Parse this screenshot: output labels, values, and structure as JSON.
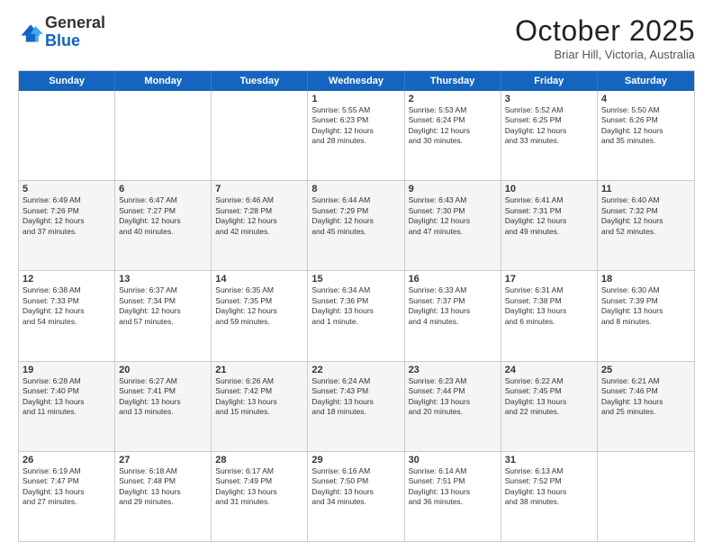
{
  "logo": {
    "general": "General",
    "blue": "Blue"
  },
  "title": "October 2025",
  "location": "Briar Hill, Victoria, Australia",
  "days": [
    "Sunday",
    "Monday",
    "Tuesday",
    "Wednesday",
    "Thursday",
    "Friday",
    "Saturday"
  ],
  "rows": [
    [
      {
        "day": "",
        "info": ""
      },
      {
        "day": "",
        "info": ""
      },
      {
        "day": "",
        "info": ""
      },
      {
        "day": "1",
        "info": "Sunrise: 5:55 AM\nSunset: 6:23 PM\nDaylight: 12 hours\nand 28 minutes."
      },
      {
        "day": "2",
        "info": "Sunrise: 5:53 AM\nSunset: 6:24 PM\nDaylight: 12 hours\nand 30 minutes."
      },
      {
        "day": "3",
        "info": "Sunrise: 5:52 AM\nSunset: 6:25 PM\nDaylight: 12 hours\nand 33 minutes."
      },
      {
        "day": "4",
        "info": "Sunrise: 5:50 AM\nSunset: 6:26 PM\nDaylight: 12 hours\nand 35 minutes."
      }
    ],
    [
      {
        "day": "5",
        "info": "Sunrise: 6:49 AM\nSunset: 7:26 PM\nDaylight: 12 hours\nand 37 minutes."
      },
      {
        "day": "6",
        "info": "Sunrise: 6:47 AM\nSunset: 7:27 PM\nDaylight: 12 hours\nand 40 minutes."
      },
      {
        "day": "7",
        "info": "Sunrise: 6:46 AM\nSunset: 7:28 PM\nDaylight: 12 hours\nand 42 minutes."
      },
      {
        "day": "8",
        "info": "Sunrise: 6:44 AM\nSunset: 7:29 PM\nDaylight: 12 hours\nand 45 minutes."
      },
      {
        "day": "9",
        "info": "Sunrise: 6:43 AM\nSunset: 7:30 PM\nDaylight: 12 hours\nand 47 minutes."
      },
      {
        "day": "10",
        "info": "Sunrise: 6:41 AM\nSunset: 7:31 PM\nDaylight: 12 hours\nand 49 minutes."
      },
      {
        "day": "11",
        "info": "Sunrise: 6:40 AM\nSunset: 7:32 PM\nDaylight: 12 hours\nand 52 minutes."
      }
    ],
    [
      {
        "day": "12",
        "info": "Sunrise: 6:38 AM\nSunset: 7:33 PM\nDaylight: 12 hours\nand 54 minutes."
      },
      {
        "day": "13",
        "info": "Sunrise: 6:37 AM\nSunset: 7:34 PM\nDaylight: 12 hours\nand 57 minutes."
      },
      {
        "day": "14",
        "info": "Sunrise: 6:35 AM\nSunset: 7:35 PM\nDaylight: 12 hours\nand 59 minutes."
      },
      {
        "day": "15",
        "info": "Sunrise: 6:34 AM\nSunset: 7:36 PM\nDaylight: 13 hours\nand 1 minute."
      },
      {
        "day": "16",
        "info": "Sunrise: 6:33 AM\nSunset: 7:37 PM\nDaylight: 13 hours\nand 4 minutes."
      },
      {
        "day": "17",
        "info": "Sunrise: 6:31 AM\nSunset: 7:38 PM\nDaylight: 13 hours\nand 6 minutes."
      },
      {
        "day": "18",
        "info": "Sunrise: 6:30 AM\nSunset: 7:39 PM\nDaylight: 13 hours\nand 8 minutes."
      }
    ],
    [
      {
        "day": "19",
        "info": "Sunrise: 6:28 AM\nSunset: 7:40 PM\nDaylight: 13 hours\nand 11 minutes."
      },
      {
        "day": "20",
        "info": "Sunrise: 6:27 AM\nSunset: 7:41 PM\nDaylight: 13 hours\nand 13 minutes."
      },
      {
        "day": "21",
        "info": "Sunrise: 6:26 AM\nSunset: 7:42 PM\nDaylight: 13 hours\nand 15 minutes."
      },
      {
        "day": "22",
        "info": "Sunrise: 6:24 AM\nSunset: 7:43 PM\nDaylight: 13 hours\nand 18 minutes."
      },
      {
        "day": "23",
        "info": "Sunrise: 6:23 AM\nSunset: 7:44 PM\nDaylight: 13 hours\nand 20 minutes."
      },
      {
        "day": "24",
        "info": "Sunrise: 6:22 AM\nSunset: 7:45 PM\nDaylight: 13 hours\nand 22 minutes."
      },
      {
        "day": "25",
        "info": "Sunrise: 6:21 AM\nSunset: 7:46 PM\nDaylight: 13 hours\nand 25 minutes."
      }
    ],
    [
      {
        "day": "26",
        "info": "Sunrise: 6:19 AM\nSunset: 7:47 PM\nDaylight: 13 hours\nand 27 minutes."
      },
      {
        "day": "27",
        "info": "Sunrise: 6:18 AM\nSunset: 7:48 PM\nDaylight: 13 hours\nand 29 minutes."
      },
      {
        "day": "28",
        "info": "Sunrise: 6:17 AM\nSunset: 7:49 PM\nDaylight: 13 hours\nand 31 minutes."
      },
      {
        "day": "29",
        "info": "Sunrise: 6:16 AM\nSunset: 7:50 PM\nDaylight: 13 hours\nand 34 minutes."
      },
      {
        "day": "30",
        "info": "Sunrise: 6:14 AM\nSunset: 7:51 PM\nDaylight: 13 hours\nand 36 minutes."
      },
      {
        "day": "31",
        "info": "Sunrise: 6:13 AM\nSunset: 7:52 PM\nDaylight: 13 hours\nand 38 minutes."
      },
      {
        "day": "",
        "info": ""
      }
    ]
  ]
}
